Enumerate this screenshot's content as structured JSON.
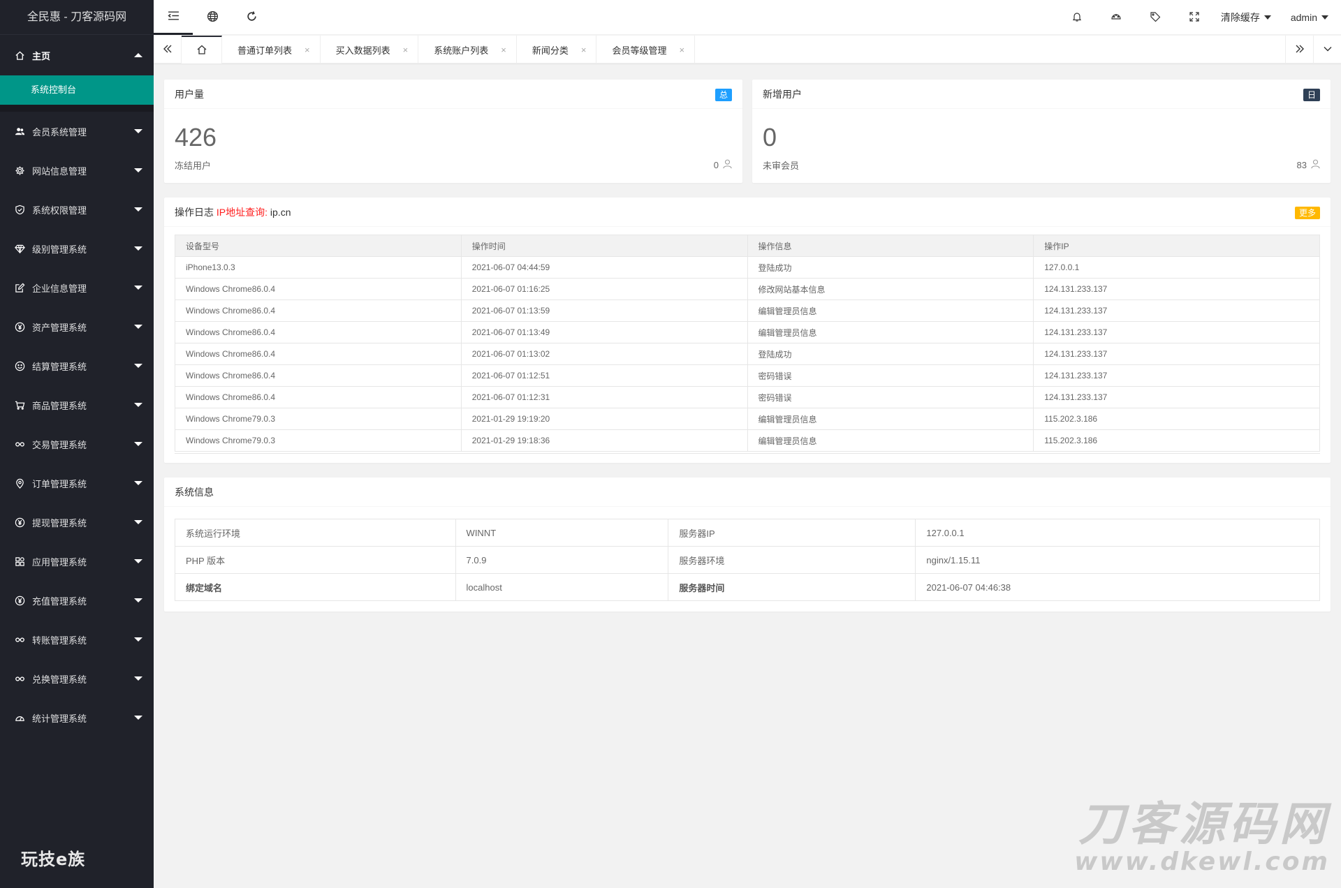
{
  "app": {
    "title": "全民惠 - 刀客源码网"
  },
  "sidebar": {
    "home": {
      "label": "主页",
      "sub": "系统控制台"
    },
    "items": [
      {
        "label": "会员系统管理",
        "icon": "users-icon"
      },
      {
        "label": "网站信息管理",
        "icon": "gear-icon"
      },
      {
        "label": "系统权限管理",
        "icon": "shield-icon"
      },
      {
        "label": "级别管理系统",
        "icon": "diamond-icon"
      },
      {
        "label": "企业信息管理",
        "icon": "edit-icon"
      },
      {
        "label": "资产管理系统",
        "icon": "yen-icon"
      },
      {
        "label": "结算管理系统",
        "icon": "smile-icon"
      },
      {
        "label": "商品管理系统",
        "icon": "cart-icon"
      },
      {
        "label": "交易管理系统",
        "icon": "link-icon"
      },
      {
        "label": "订单管理系统",
        "icon": "location-icon"
      },
      {
        "label": "提现管理系统",
        "icon": "yen-icon"
      },
      {
        "label": "应用管理系统",
        "icon": "apps-icon"
      },
      {
        "label": "充值管理系统",
        "icon": "yen-icon"
      },
      {
        "label": "转账管理系统",
        "icon": "link-icon"
      },
      {
        "label": "兑换管理系统",
        "icon": "link-icon"
      },
      {
        "label": "统计管理系统",
        "icon": "dashboard-icon"
      }
    ],
    "brand": "玩技e族"
  },
  "header": {
    "clear_cache": "清除缓存",
    "user": "admin"
  },
  "tabs": [
    {
      "label": "普通订单列表"
    },
    {
      "label": "买入数据列表"
    },
    {
      "label": "系统账户列表"
    },
    {
      "label": "新闻分类"
    },
    {
      "label": "会员等级管理"
    }
  ],
  "tab_close": "×",
  "stats": {
    "users": {
      "title": "用户量",
      "badge": "总",
      "badge_color": "#1e9fff",
      "value": "426",
      "sub": "冻结用户",
      "right": "0"
    },
    "new_users": {
      "title": "新增用户",
      "badge": "日",
      "badge_color": "#2f4056",
      "value": "0",
      "sub": "未审会员",
      "right": "83"
    }
  },
  "log": {
    "title": "操作日志",
    "ip_query": "IP地址查询:",
    "ip_site": "ip.cn",
    "more": "更多",
    "more_color": "#ffb800",
    "columns": [
      "设备型号",
      "操作时间",
      "操作信息",
      "操作IP"
    ],
    "rows": [
      [
        "iPhone13.0.3",
        "2021-06-07 04:44:59",
        "登陆成功",
        "127.0.0.1"
      ],
      [
        "Windows Chrome86.0.4",
        "2021-06-07 01:16:25",
        "修改网站基本信息",
        "124.131.233.137"
      ],
      [
        "Windows Chrome86.0.4",
        "2021-06-07 01:13:59",
        "编辑管理员信息",
        "124.131.233.137"
      ],
      [
        "Windows Chrome86.0.4",
        "2021-06-07 01:13:49",
        "编辑管理员信息",
        "124.131.233.137"
      ],
      [
        "Windows Chrome86.0.4",
        "2021-06-07 01:13:02",
        "登陆成功",
        "124.131.233.137"
      ],
      [
        "Windows Chrome86.0.4",
        "2021-06-07 01:12:51",
        "密码错误",
        "124.131.233.137"
      ],
      [
        "Windows Chrome86.0.4",
        "2021-06-07 01:12:31",
        "密码错误",
        "124.131.233.137"
      ],
      [
        "Windows Chrome79.0.3",
        "2021-01-29 19:19:20",
        "编辑管理员信息",
        "115.202.3.186"
      ],
      [
        "Windows Chrome79.0.3",
        "2021-01-29 19:18:36",
        "编辑管理员信息",
        "115.202.3.186"
      ]
    ]
  },
  "sysinfo": {
    "title": "系统信息",
    "rows": [
      [
        "系统运行环境",
        "WINNT",
        "服务器IP",
        "127.0.0.1"
      ],
      [
        "PHP 版本",
        "7.0.9",
        "服务器环境",
        "nginx/1.15.11"
      ],
      [
        "绑定域名",
        "localhost",
        "服务器时间",
        "2021-06-07 04:46:38"
      ]
    ]
  },
  "watermark": {
    "line1": "刀客源码网",
    "line2": "www.dkewl.com"
  }
}
